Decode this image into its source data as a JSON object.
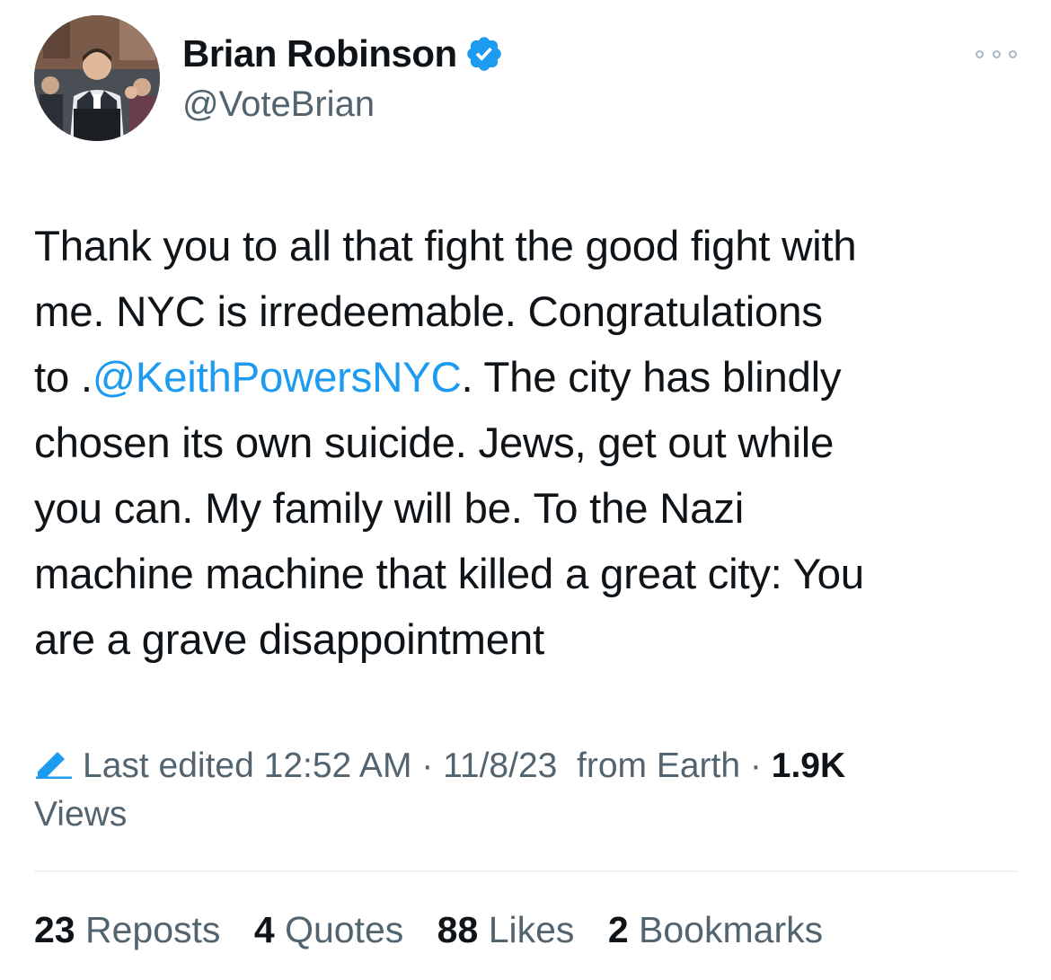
{
  "author": {
    "display_name": "Brian Robinson",
    "handle": "@VoteBrian",
    "verified": true,
    "avatar_icon": "profile-photo",
    "verified_icon": "verified-badge-icon"
  },
  "menu": {
    "more_icon": "more-options-icon"
  },
  "tweet": {
    "lines": [
      {
        "text": "Thank you to all that fight the good fight with"
      },
      {
        "text": "me. NYC is irredeemable. Congratulations"
      },
      {
        "pre": "to .",
        "mention": "@KeithPowersNYC",
        "post": ". The city has blindly"
      },
      {
        "text": "chosen its own suicide. Jews, get out while"
      },
      {
        "text": "you can. My family will be. To the Nazi"
      },
      {
        "text": "machine machine that killed a great city: You"
      },
      {
        "text": "are a grave disappointment"
      }
    ]
  },
  "meta": {
    "edit_icon": "pencil-icon",
    "edited_label": "Last edited 12:52 AM",
    "separator": " · ",
    "date": "11/8/23",
    "source": "from Earth",
    "views_count": "1.9K",
    "views_label": "Views"
  },
  "stats": {
    "reposts_count": "23",
    "reposts_label": "Reposts",
    "quotes_count": "4",
    "quotes_label": "Quotes",
    "likes_count": "88",
    "likes_label": "Likes",
    "bookmarks_count": "2",
    "bookmarks_label": "Bookmarks"
  },
  "colors": {
    "link": "#1d9bf0",
    "text": "#0f1419",
    "secondary": "#536471"
  }
}
